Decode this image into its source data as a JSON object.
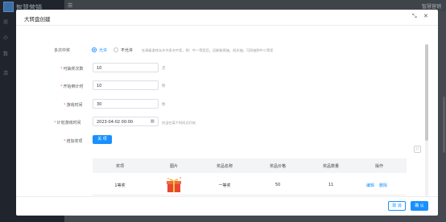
{
  "background": {
    "brand": "智慧营销",
    "nav_items": [
      "运",
      "小",
      "数",
      "活"
    ],
    "user": "智慧营销",
    "hamburger_glyph": "☰"
  },
  "modal": {
    "title": "大转盘创建",
    "expand_glyph": "⤡",
    "close_glyph": "✕",
    "form": {
      "multi_win": {
        "label": "多次中奖",
        "options": [
          "允许",
          "不允许"
        ],
        "selected": "允许",
        "hint": "在高级游戏允许许多次中奖，例：中一等奖后，还能能再抽，低次抽，可再抽到中二等奖"
      },
      "draw_count": {
        "label": "可抽奖次数",
        "value": "10",
        "unit": "次"
      },
      "countdown": {
        "label": "开始倒计时",
        "value": "10",
        "unit": "秒"
      },
      "game_time": {
        "label": "游戏时间",
        "value": "30",
        "unit": "秒"
      },
      "schedule": {
        "label": "计划游戏时间",
        "value": "2023-04-02 00:00",
        "hint": "仅当在某个时间点开始",
        "calendar_glyph": "▦"
      },
      "add_prize": {
        "label": "增加奖项",
        "button": "关 项"
      }
    },
    "settings_glyph": "⁝⁝",
    "table": {
      "columns": [
        "奖项",
        "图片",
        "奖品名称",
        "奖品价格",
        "奖品数量",
        "操作"
      ],
      "rows": [
        {
          "tier": "1等奖",
          "name": "一等奖",
          "price": "50",
          "quantity": "11",
          "edit": "编辑",
          "delete": "删除"
        }
      ]
    },
    "footer": {
      "cancel": "取 消",
      "ok": "确 认"
    }
  },
  "colors": {
    "primary": "#1890ff",
    "required": "#f56c6c",
    "overlay": "#3d4149"
  }
}
